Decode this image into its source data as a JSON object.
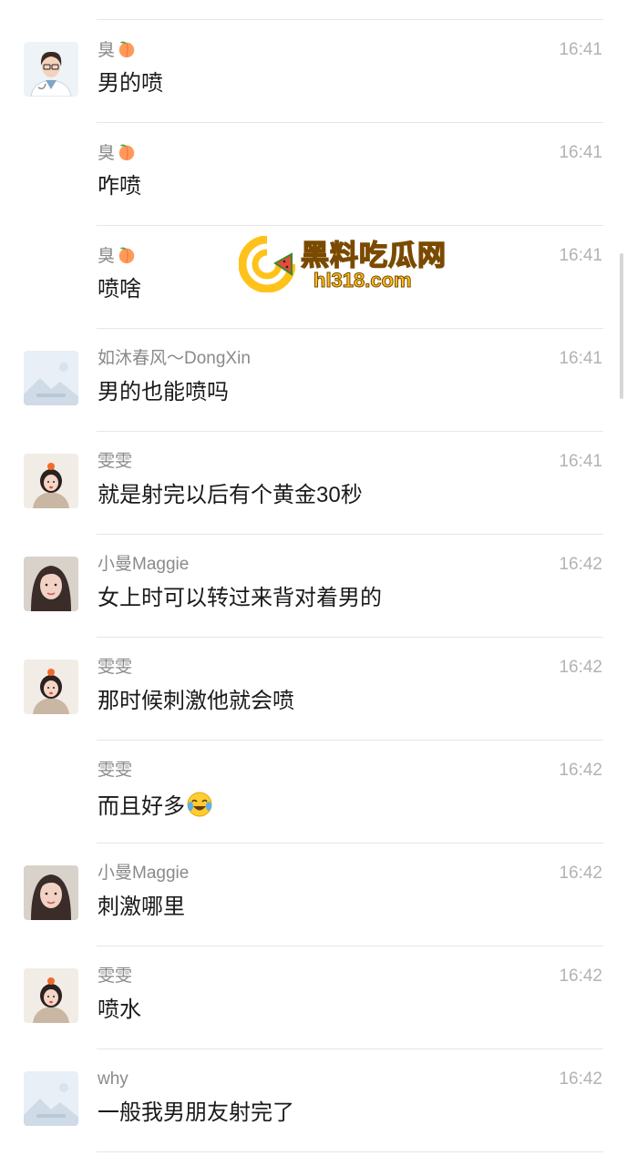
{
  "watermark": {
    "title": "黑料吃瓜网",
    "url": "hl318.com"
  },
  "messages": [
    {
      "sender": "臭",
      "sender_emoji": "peach-icon",
      "time": "16:41",
      "text": "男的喷",
      "avatar": "doctor-avatar",
      "show_avatar": true
    },
    {
      "sender": "臭",
      "sender_emoji": "peach-icon",
      "time": "16:41",
      "text": "咋喷",
      "avatar": "doctor-avatar",
      "show_avatar": false
    },
    {
      "sender": "臭",
      "sender_emoji": "peach-icon",
      "time": "16:41",
      "text": "喷啥",
      "avatar": "doctor-avatar",
      "show_avatar": false
    },
    {
      "sender": "如沐春风～DongXin",
      "time": "16:41",
      "text": "男的也能喷吗",
      "avatar": "placeholder-avatar",
      "show_avatar": true
    },
    {
      "sender": "雯雯",
      "time": "16:41",
      "text": "就是射完以后有个黄金30秒",
      "avatar": "girl-avatar",
      "show_avatar": true
    },
    {
      "sender": "小曼Maggie",
      "time": "16:42",
      "text": "女上时可以转过来背对着男的",
      "avatar": "woman-avatar",
      "show_avatar": true
    },
    {
      "sender": "雯雯",
      "time": "16:42",
      "text": "那时候刺激他就会喷",
      "avatar": "girl-avatar",
      "show_avatar": true
    },
    {
      "sender": "雯雯",
      "time": "16:42",
      "text": "而且好多",
      "text_emoji": "laughing-crying-icon",
      "avatar": "girl-avatar",
      "show_avatar": false
    },
    {
      "sender": "小曼Maggie",
      "time": "16:42",
      "text": "刺激哪里",
      "avatar": "woman-avatar",
      "show_avatar": true
    },
    {
      "sender": "雯雯",
      "time": "16:42",
      "text": "喷水",
      "avatar": "girl-avatar",
      "show_avatar": true
    },
    {
      "sender": "why",
      "time": "16:42",
      "text": "一般我男朋友射完了",
      "avatar": "placeholder-avatar",
      "show_avatar": true
    }
  ]
}
